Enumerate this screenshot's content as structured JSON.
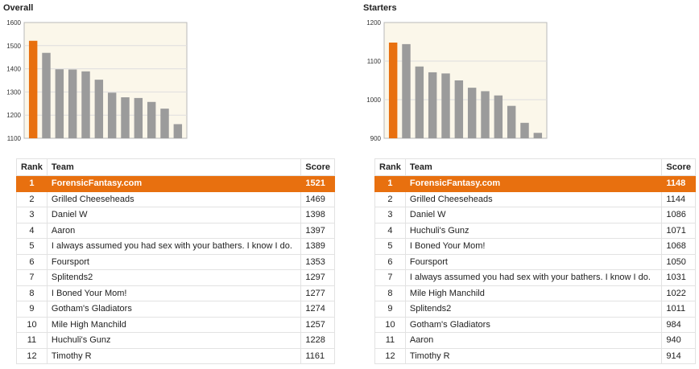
{
  "colors": {
    "highlight": "#e8700f",
    "bar": "#9b9b9b",
    "grid": "#dedede",
    "plot_bg": "#fbf7ea"
  },
  "table_headers": {
    "rank": "Rank",
    "team": "Team",
    "score": "Score"
  },
  "chart_data": [
    {
      "type": "bar",
      "title": "Overall",
      "ylim": [
        1100,
        1600
      ],
      "yticks": [
        1100,
        1200,
        1300,
        1400,
        1500,
        1600
      ],
      "grid": true,
      "highlight_index": 0,
      "categories": [
        "ForensicFantasy.com",
        "Grilled Cheeseheads",
        "Daniel W",
        "Aaron",
        "I always assumed you had sex with your bathers. I know I do.",
        "Foursport",
        "Splitends2",
        "I Boned Your Mom!",
        "Gotham's Gladiators",
        "Mile High Manchild",
        "Huchuli's Gunz",
        "Timothy R"
      ],
      "values": [
        1521,
        1469,
        1398,
        1397,
        1389,
        1353,
        1297,
        1277,
        1274,
        1257,
        1228,
        1161
      ]
    },
    {
      "type": "bar",
      "title": "Starters",
      "ylim": [
        900,
        1200
      ],
      "yticks": [
        900,
        1000,
        1100,
        1200
      ],
      "grid": true,
      "highlight_index": 0,
      "categories": [
        "ForensicFantasy.com",
        "Grilled Cheeseheads",
        "Daniel W",
        "Huchuli's Gunz",
        "I Boned Your Mom!",
        "Foursport",
        "I always assumed you had sex with your bathers. I know I do.",
        "Mile High Manchild",
        "Splitends2",
        "Gotham's Gladiators",
        "Aaron",
        "Timothy R"
      ],
      "values": [
        1148,
        1144,
        1086,
        1071,
        1068,
        1050,
        1031,
        1022,
        1011,
        984,
        940,
        914
      ]
    }
  ],
  "tables": [
    {
      "rows": [
        {
          "rank": "1",
          "team": "ForensicFantasy.com",
          "score": "1521",
          "highlight": true
        },
        {
          "rank": "2",
          "team": "Grilled Cheeseheads",
          "score": "1469"
        },
        {
          "rank": "3",
          "team": "Daniel W",
          "score": "1398"
        },
        {
          "rank": "4",
          "team": "Aaron",
          "score": "1397"
        },
        {
          "rank": "5",
          "team": "I always assumed you had sex with your bathers. I know I do.",
          "score": "1389"
        },
        {
          "rank": "6",
          "team": "Foursport",
          "score": "1353"
        },
        {
          "rank": "7",
          "team": "Splitends2",
          "score": "1297"
        },
        {
          "rank": "8",
          "team": "I Boned Your Mom!",
          "score": "1277"
        },
        {
          "rank": "9",
          "team": "Gotham's Gladiators",
          "score": "1274"
        },
        {
          "rank": "10",
          "team": "Mile High Manchild",
          "score": "1257"
        },
        {
          "rank": "11",
          "team": "Huchuli's Gunz",
          "score": "1228"
        },
        {
          "rank": "12",
          "team": "Timothy R",
          "score": "1161"
        }
      ]
    },
    {
      "rows": [
        {
          "rank": "1",
          "team": "ForensicFantasy.com",
          "score": "1148",
          "highlight": true
        },
        {
          "rank": "2",
          "team": "Grilled Cheeseheads",
          "score": "1144"
        },
        {
          "rank": "3",
          "team": "Daniel W",
          "score": "1086"
        },
        {
          "rank": "4",
          "team": "Huchuli's Gunz",
          "score": "1071"
        },
        {
          "rank": "5",
          "team": "I Boned Your Mom!",
          "score": "1068"
        },
        {
          "rank": "6",
          "team": "Foursport",
          "score": "1050"
        },
        {
          "rank": "7",
          "team": "I always assumed you had sex with your bathers. I know I do.",
          "score": "1031"
        },
        {
          "rank": "8",
          "team": "Mile High Manchild",
          "score": "1022"
        },
        {
          "rank": "9",
          "team": "Splitends2",
          "score": "1011"
        },
        {
          "rank": "10",
          "team": "Gotham's Gladiators",
          "score": "984"
        },
        {
          "rank": "11",
          "team": "Aaron",
          "score": "940"
        },
        {
          "rank": "12",
          "team": "Timothy R",
          "score": "914"
        }
      ]
    }
  ]
}
